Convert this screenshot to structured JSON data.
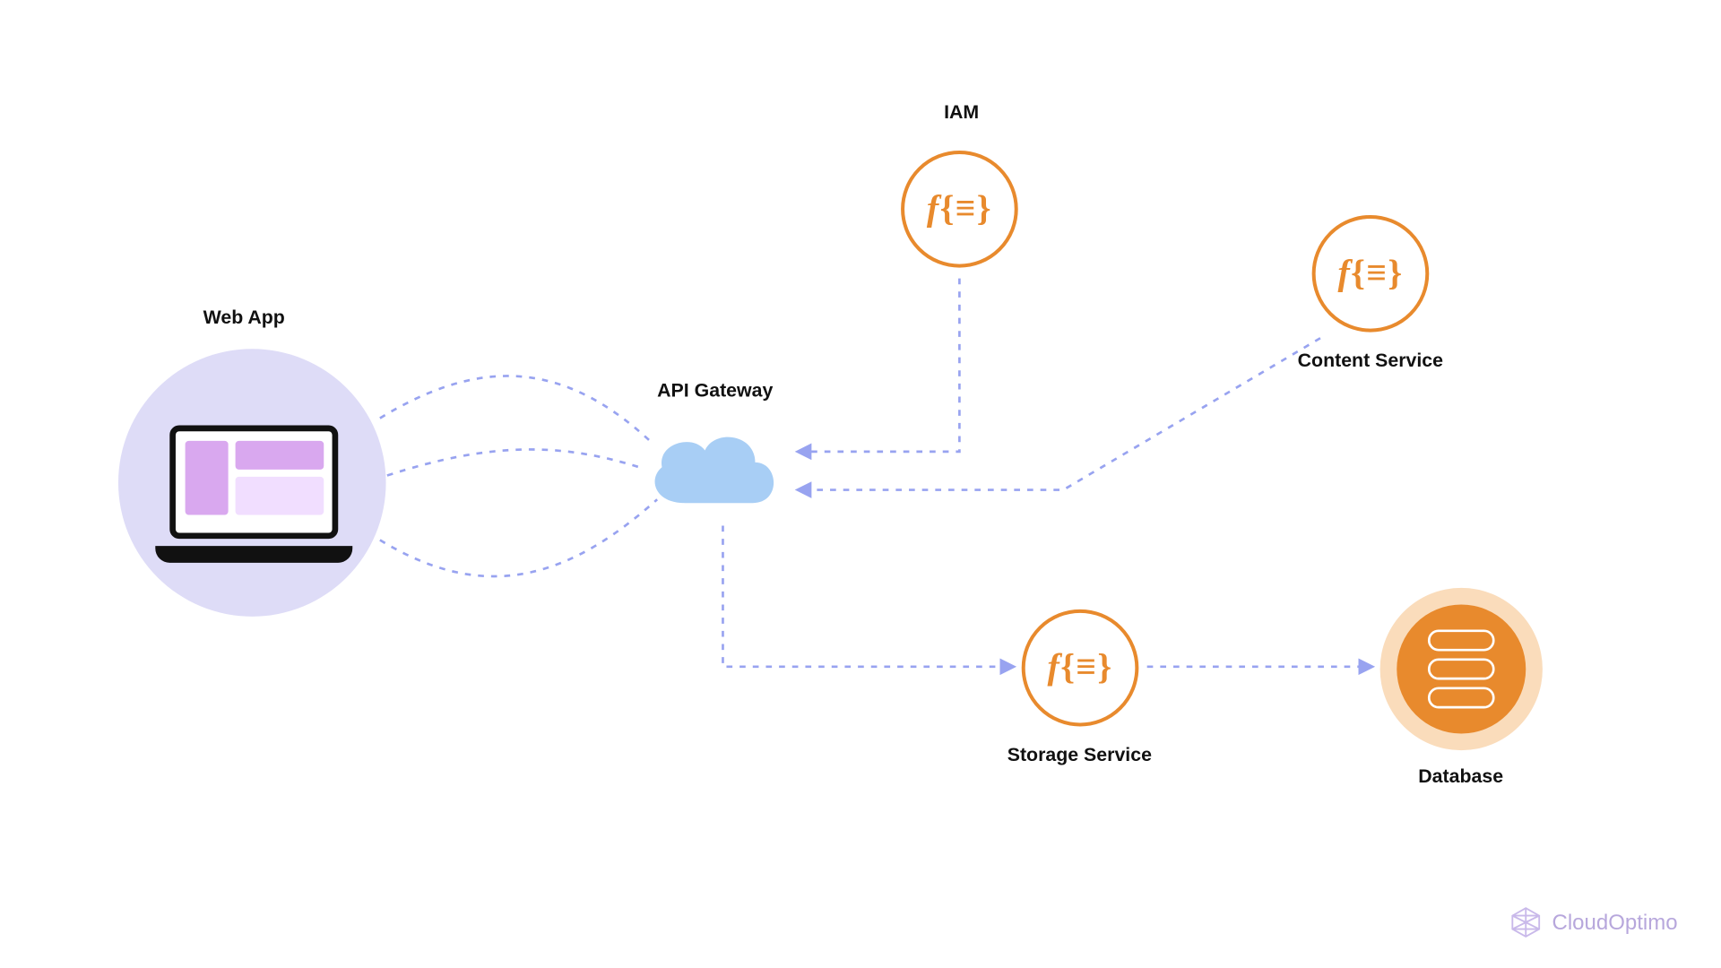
{
  "nodes": {
    "webapp": {
      "label": "Web App"
    },
    "gateway": {
      "label": "API Gateway"
    },
    "iam": {
      "label": "IAM"
    },
    "content": {
      "label": "Content Service"
    },
    "storage": {
      "label": "Storage Service"
    },
    "database": {
      "label": "Database"
    }
  },
  "connectors": [
    {
      "from": "webapp",
      "to": "gateway",
      "style": "curved",
      "count": 3
    },
    {
      "from": "iam",
      "to": "gateway",
      "style": "elbow-down-left",
      "arrow": "to"
    },
    {
      "from": "content",
      "to": "gateway",
      "style": "diag-then-left",
      "arrow": "to"
    },
    {
      "from": "gateway",
      "to": "storage",
      "style": "down-right",
      "arrow": "to"
    },
    {
      "from": "storage",
      "to": "database",
      "style": "straight-right",
      "arrow": "to"
    }
  ],
  "branding": {
    "name": "CloudOptimo"
  },
  "colors": {
    "halo": "#dedcf7",
    "cloud": "#a8cef5",
    "accent": "#e88a2d",
    "connector": "#98a3f0",
    "brand": "#b7a7dc"
  }
}
